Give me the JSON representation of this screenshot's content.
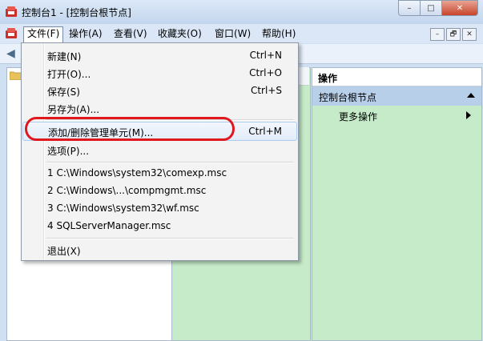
{
  "window": {
    "title": "控制台1 - [控制台根节点]",
    "controls": {
      "minimize": "–",
      "maximize": "□",
      "close": "✕"
    }
  },
  "menubar": {
    "items": [
      {
        "label": "文件(F)"
      },
      {
        "label": "操作(A)"
      },
      {
        "label": "查看(V)"
      },
      {
        "label": "收藏夹(O)"
      },
      {
        "label": "窗口(W)"
      },
      {
        "label": "帮助(H)"
      }
    ],
    "child_controls": {
      "minimize": "–",
      "restore": "🗗",
      "close": "✕"
    }
  },
  "file_menu": {
    "items": [
      {
        "label": "新建(N)",
        "shortcut": "Ctrl+N"
      },
      {
        "label": "打开(O)...",
        "shortcut": "Ctrl+O"
      },
      {
        "label": "保存(S)",
        "shortcut": "Ctrl+S"
      },
      {
        "label": "另存为(A)...",
        "shortcut": ""
      },
      {
        "label": "添加/删除管理单元(M)...",
        "shortcut": "Ctrl+M"
      },
      {
        "label": "选项(P)...",
        "shortcut": ""
      },
      {
        "label": "1 C:\\Windows\\system32\\comexp.msc",
        "shortcut": ""
      },
      {
        "label": "2 C:\\Windows\\...\\compmgmt.msc",
        "shortcut": ""
      },
      {
        "label": "3 C:\\Windows\\system32\\wf.msc",
        "shortcut": ""
      },
      {
        "label": "4 SQLServerManager.msc",
        "shortcut": ""
      },
      {
        "label": "退出(X)",
        "shortcut": ""
      }
    ],
    "highlighted_index": 4
  },
  "actions_pane": {
    "header": "操作",
    "section": "控制台根节点",
    "item": "更多操作"
  },
  "colors": {
    "pane_green": "#c6ebc9",
    "highlight_ring": "#e0171d",
    "section_blue": "#b7cfe9"
  }
}
